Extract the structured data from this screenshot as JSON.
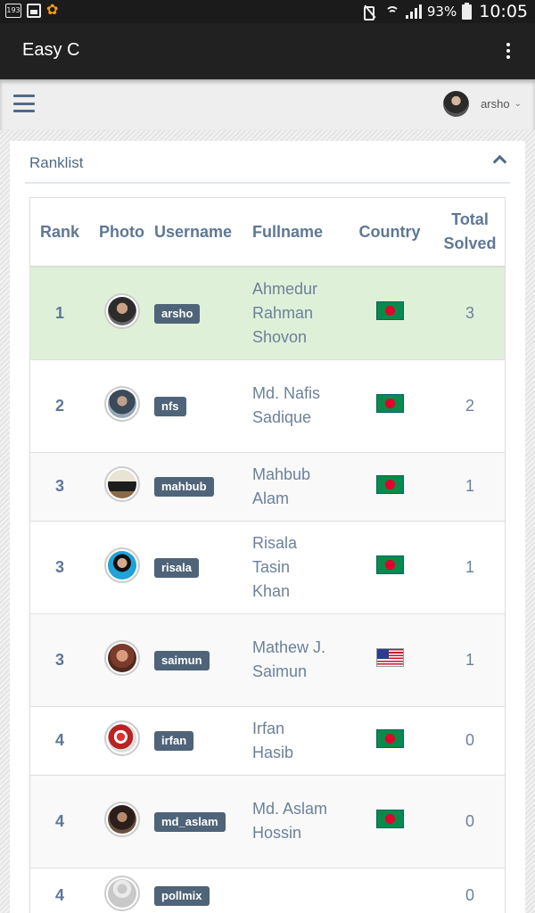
{
  "status_bar": {
    "left_badge": "193",
    "battery": "93%",
    "time": "10:05"
  },
  "app": {
    "title": "Easy C"
  },
  "header": {
    "user": "arsho"
  },
  "panel": {
    "title": "Ranklist"
  },
  "table": {
    "columns": [
      "Rank",
      "Photo",
      "Username",
      "Fullname",
      "Country",
      "Total Solved"
    ],
    "rows": [
      {
        "rank": "1",
        "username": "arsho",
        "fullname": "Ahmedur Rahman Shovon",
        "country": "bd",
        "solved": "3",
        "avatar": "person-dark"
      },
      {
        "rank": "2",
        "username": "nfs",
        "fullname": "Md. Nafis Sadique",
        "country": "bd",
        "solved": "2",
        "avatar": "person-glasses"
      },
      {
        "rank": "3",
        "username": "mahbub",
        "fullname": "Mahbub Alam",
        "country": "bd",
        "solved": "1",
        "avatar": "person-standing"
      },
      {
        "rank": "3",
        "username": "risala",
        "fullname": "Risala Tasin Khan",
        "country": "bd",
        "solved": "1",
        "avatar": "person-female"
      },
      {
        "rank": "3",
        "username": "saimun",
        "fullname": "Mathew J. Saimun",
        "country": "us",
        "solved": "1",
        "avatar": "person-red"
      },
      {
        "rank": "4",
        "username": "irfan",
        "fullname": "Irfan Hasib",
        "country": "bd",
        "solved": "0",
        "avatar": "person-crowd"
      },
      {
        "rank": "4",
        "username": "md_aslam",
        "fullname": "Md. Aslam Hossin",
        "country": "bd",
        "solved": "0",
        "avatar": "person-beard"
      },
      {
        "rank": "4",
        "username": "pollmix",
        "fullname": "",
        "country": "",
        "solved": "0",
        "avatar": "default-avatar"
      }
    ]
  }
}
